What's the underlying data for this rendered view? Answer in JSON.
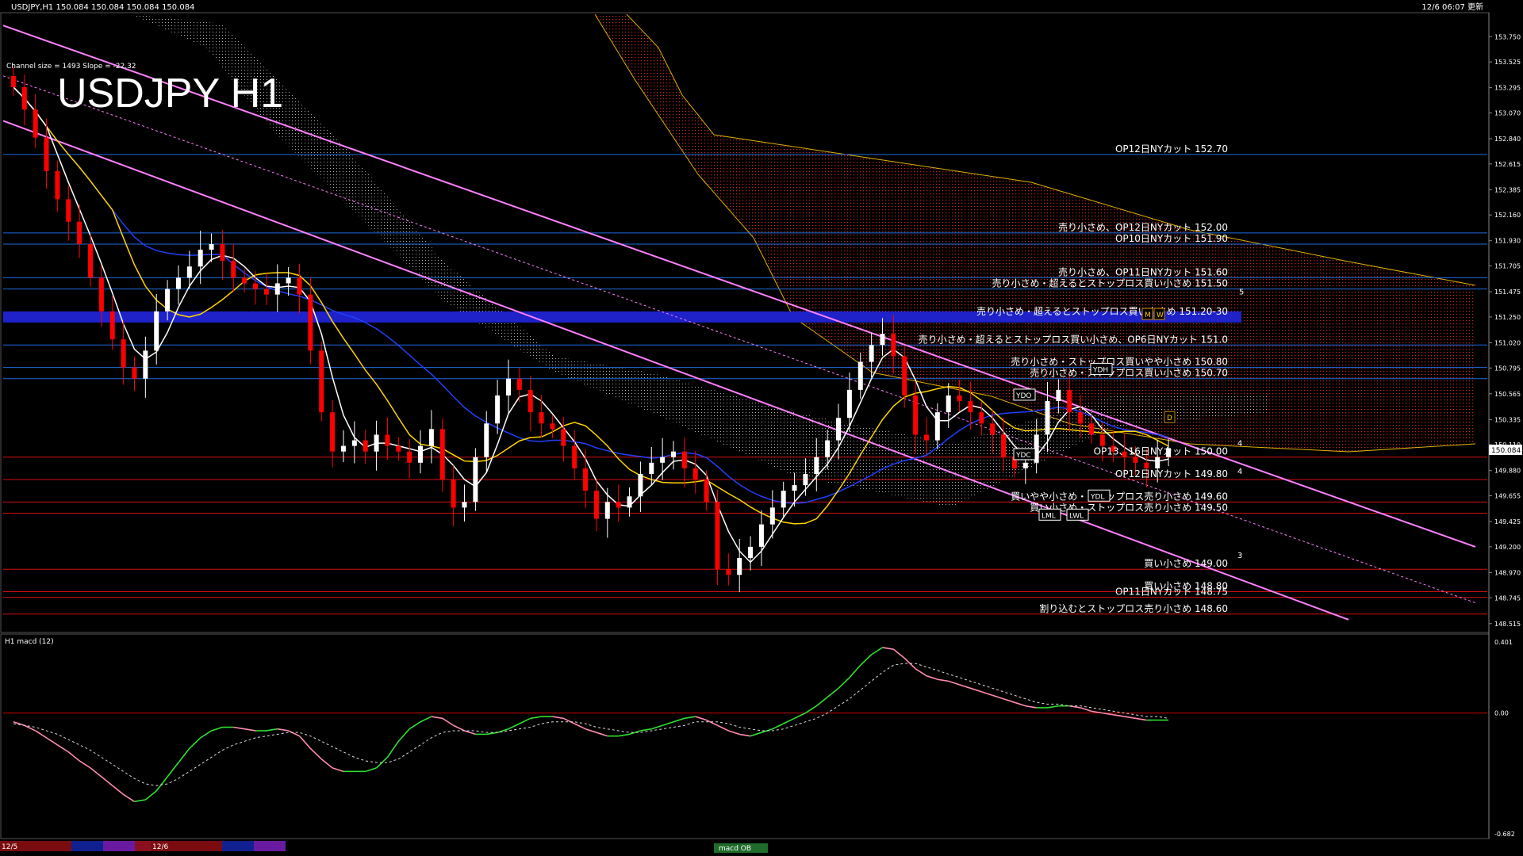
{
  "header": {
    "symbol_line": "USDJPY,H1  150.084 150.084 150.084 150.084",
    "datetime_line": "12/6 06:07 更新",
    "channel_info": "Channel size = 1493 Slope = -22.32",
    "big_title": "USDJPY H1"
  },
  "macd_header": "H1  macd (12)",
  "bottom_tabs": [
    "12/5",
    "12/6"
  ],
  "bottom_center_label": "macd OB",
  "colors": {
    "bg": "#000000",
    "bull_candle": "#ffffff",
    "bear_candle": "#ff0000",
    "hline_blue": "#1e6be0",
    "hline_red": "#d11010",
    "channel": "#ff80ff",
    "ma_white": "#ffffff",
    "ma_yellow": "#ffd400",
    "ma_blue": "#2040ff",
    "cloud_outline": "#e0b000",
    "macd_up": "#30e030",
    "macd_down": "#ff8cb0"
  },
  "chart_data": {
    "type": "candlestick",
    "symbol": "USDJPY",
    "timeframe": "H1",
    "last_price": "150.084",
    "price_axis_ticks": [
      "153.750",
      "153.525",
      "153.295",
      "153.070",
      "152.840",
      "152.615",
      "152.385",
      "152.160",
      "151.930",
      "151.705",
      "151.475",
      "151.250",
      "151.020",
      "150.795",
      "150.565",
      "150.335",
      "150.110",
      "149.880",
      "149.655",
      "149.425",
      "149.200",
      "148.970",
      "148.745",
      "148.515"
    ],
    "price_range": [
      148.45,
      153.95
    ],
    "levels": [
      {
        "label": "OP12日NYカット 152.70",
        "price": 152.7,
        "color": "blue"
      },
      {
        "label": "売り小さめ、OP12日NYカット 152.00",
        "price": 152.0,
        "color": "blue"
      },
      {
        "label": "OP10日NYカット 151.90",
        "price": 151.9,
        "color": "blue"
      },
      {
        "label": "売り小さめ、OP11日NYカット 151.60",
        "price": 151.6,
        "color": "blue"
      },
      {
        "label": "売り小さめ・超えるとストップロス買い小さめ 151.50",
        "price": 151.5,
        "color": "blue"
      },
      {
        "label": "売り小さめ・超えるとストップロス買い小さめ 151.20-30",
        "price": 151.25,
        "color": "blue_zone"
      },
      {
        "label": "売り小さめ・超えるとストップロス買い小さめ、OP6日NYカット 151.0",
        "price": 151.0,
        "color": "blue"
      },
      {
        "label": "売り小さめ・ストップロス買いやや小さめ 150.80",
        "price": 150.8,
        "color": "blue"
      },
      {
        "label": "売り小さめ・ストップロス買い小さめ 150.70",
        "price": 150.7,
        "color": "blue"
      },
      {
        "label": "OP13、16日NYカット 150.00",
        "price": 150.0,
        "color": "red"
      },
      {
        "label": "OP12日NYカット 149.80",
        "price": 149.8,
        "color": "red"
      },
      {
        "label": "買いやや小さめ・ストップロス売り小さめ 149.60",
        "price": 149.6,
        "color": "red"
      },
      {
        "label": "買い小さめ・ストップロス売り小さめ 149.50",
        "price": 149.5,
        "color": "red"
      },
      {
        "label": "買い小さめ 149.00",
        "price": 149.0,
        "color": "red"
      },
      {
        "label": "買い小さめ 148.80",
        "price": 148.8,
        "color": "red"
      },
      {
        "label": "OP11日NYカット 148.75",
        "price": 148.75,
        "color": "red"
      },
      {
        "label": "割り込むとストップロス売り小さめ 148.60",
        "price": 148.6,
        "color": "red"
      }
    ],
    "closes": [
      153.3,
      153.1,
      152.85,
      152.55,
      152.3,
      152.1,
      151.9,
      151.6,
      151.3,
      151.05,
      150.8,
      150.7,
      150.95,
      151.3,
      151.5,
      151.6,
      151.7,
      151.85,
      151.9,
      151.75,
      151.6,
      151.55,
      151.5,
      151.45,
      151.55,
      151.6,
      151.45,
      150.95,
      150.4,
      150.05,
      150.1,
      150.15,
      150.05,
      150.2,
      150.1,
      150.05,
      149.95,
      150.1,
      150.25,
      149.8,
      149.55,
      149.6,
      150.0,
      150.3,
      150.55,
      150.7,
      150.6,
      150.4,
      150.3,
      150.25,
      150.1,
      149.9,
      149.7,
      149.45,
      149.6,
      149.55,
      149.65,
      149.85,
      149.95,
      150.0,
      150.05,
      149.9,
      149.8,
      149.6,
      149.0,
      148.95,
      149.1,
      149.2,
      149.4,
      149.55,
      149.7,
      149.75,
      149.85,
      150.0,
      150.15,
      150.35,
      150.6,
      150.85,
      151.0,
      151.1,
      150.9,
      150.55,
      150.2,
      150.15,
      150.4,
      150.55,
      150.5,
      150.4,
      150.3,
      150.2,
      150.0,
      149.9,
      149.95,
      150.2,
      150.5,
      150.6,
      150.4,
      150.3,
      150.2,
      150.1,
      150.05,
      150.0,
      149.95,
      149.9,
      150.0,
      150.08
    ],
    "macd": {
      "axis_ticks": [
        "0.401",
        "0.00",
        "-0.682"
      ],
      "range": [
        -0.682,
        0.401
      ],
      "main": [
        -0.05,
        -0.07,
        -0.1,
        -0.14,
        -0.18,
        -0.22,
        -0.27,
        -0.31,
        -0.36,
        -0.41,
        -0.46,
        -0.5,
        -0.49,
        -0.44,
        -0.36,
        -0.28,
        -0.2,
        -0.14,
        -0.1,
        -0.08,
        -0.08,
        -0.09,
        -0.1,
        -0.1,
        -0.09,
        -0.1,
        -0.13,
        -0.2,
        -0.26,
        -0.31,
        -0.33,
        -0.33,
        -0.33,
        -0.31,
        -0.25,
        -0.16,
        -0.09,
        -0.05,
        -0.02,
        -0.03,
        -0.07,
        -0.1,
        -0.12,
        -0.12,
        -0.11,
        -0.09,
        -0.06,
        -0.03,
        -0.02,
        -0.02,
        -0.03,
        -0.06,
        -0.09,
        -0.11,
        -0.13,
        -0.13,
        -0.12,
        -0.1,
        -0.09,
        -0.07,
        -0.05,
        -0.03,
        -0.02,
        -0.04,
        -0.07,
        -0.1,
        -0.12,
        -0.13,
        -0.11,
        -0.09,
        -0.06,
        -0.03,
        0.0,
        0.04,
        0.09,
        0.14,
        0.2,
        0.27,
        0.33,
        0.37,
        0.36,
        0.31,
        0.25,
        0.21,
        0.19,
        0.18,
        0.16,
        0.14,
        0.12,
        0.1,
        0.08,
        0.06,
        0.04,
        0.03,
        0.03,
        0.04,
        0.04,
        0.03,
        0.01,
        0.0,
        -0.01,
        -0.02,
        -0.03,
        -0.04,
        -0.04,
        -0.04
      ],
      "signal": [
        -0.06,
        -0.07,
        -0.08,
        -0.1,
        -0.12,
        -0.15,
        -0.18,
        -0.21,
        -0.25,
        -0.29,
        -0.33,
        -0.37,
        -0.4,
        -0.41,
        -0.4,
        -0.37,
        -0.33,
        -0.29,
        -0.25,
        -0.21,
        -0.18,
        -0.16,
        -0.14,
        -0.13,
        -0.12,
        -0.11,
        -0.11,
        -0.13,
        -0.16,
        -0.19,
        -0.22,
        -0.25,
        -0.27,
        -0.28,
        -0.28,
        -0.26,
        -0.22,
        -0.18,
        -0.14,
        -0.11,
        -0.1,
        -0.1,
        -0.1,
        -0.11,
        -0.11,
        -0.1,
        -0.09,
        -0.08,
        -0.06,
        -0.05,
        -0.05,
        -0.05,
        -0.06,
        -0.08,
        -0.09,
        -0.1,
        -0.11,
        -0.11,
        -0.1,
        -0.09,
        -0.08,
        -0.07,
        -0.05,
        -0.05,
        -0.05,
        -0.06,
        -0.08,
        -0.09,
        -0.1,
        -0.1,
        -0.09,
        -0.07,
        -0.05,
        -0.03,
        0.0,
        0.04,
        0.08,
        0.13,
        0.18,
        0.23,
        0.27,
        0.28,
        0.28,
        0.26,
        0.24,
        0.22,
        0.2,
        0.18,
        0.16,
        0.14,
        0.12,
        0.1,
        0.08,
        0.06,
        0.05,
        0.05,
        0.04,
        0.04,
        0.03,
        0.02,
        0.01,
        0.0,
        -0.01,
        -0.02,
        -0.02,
        -0.03
      ]
    },
    "wave_labels": [
      {
        "text": "5",
        "price": 151.45
      },
      {
        "text": "4",
        "price": 150.1
      },
      {
        "text": "4",
        "price": 149.85
      },
      {
        "text": "3",
        "price": 149.1
      }
    ],
    "box_labels": [
      "YDO",
      "YDC",
      "YDH",
      "YDL",
      "LML",
      "LWL",
      "M",
      "W",
      "D"
    ]
  }
}
